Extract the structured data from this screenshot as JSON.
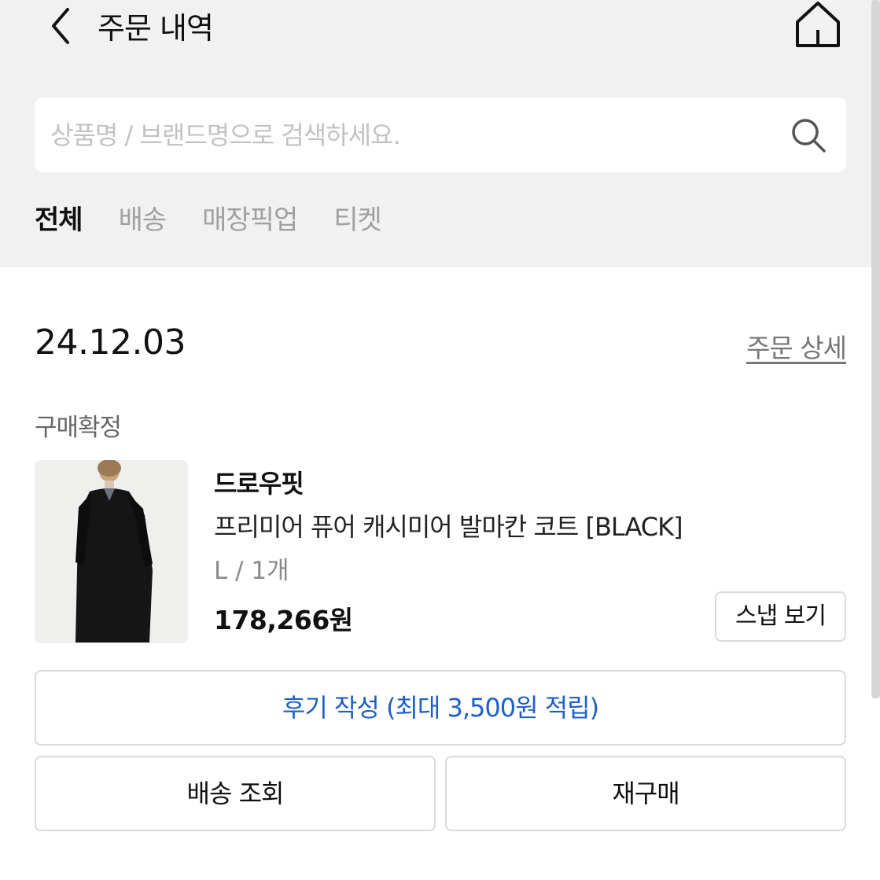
{
  "header": {
    "title": "주문 내역",
    "back_icon": "chevron-left-icon",
    "home_icon": "home-icon"
  },
  "search": {
    "placeholder": "상품명 / 브랜드명으로 검색하세요.",
    "value": "",
    "icon": "search-icon"
  },
  "tabs": [
    {
      "label": "전체",
      "active": true
    },
    {
      "label": "배송",
      "active": false
    },
    {
      "label": "매장픽업",
      "active": false
    },
    {
      "label": "티켓",
      "active": false
    }
  ],
  "order": {
    "date": "24.12.03",
    "detail_link": "주문 상세",
    "status": "구매확정",
    "item": {
      "brand": "드로우핏",
      "name": "프리미어 퓨어 캐시미어 발마칸 코트 [BLACK]",
      "option": "L / 1개",
      "price": "178,266원",
      "snap_button": "스냅 보기"
    },
    "buttons": {
      "review": "후기 작성 (최대 3,500원 적립)",
      "track": "배송 조회",
      "rebuy": "재구매"
    }
  },
  "colors": {
    "top_background": "#f1f1f1",
    "review_text": "#1f5fc8",
    "border": "#dadada"
  }
}
